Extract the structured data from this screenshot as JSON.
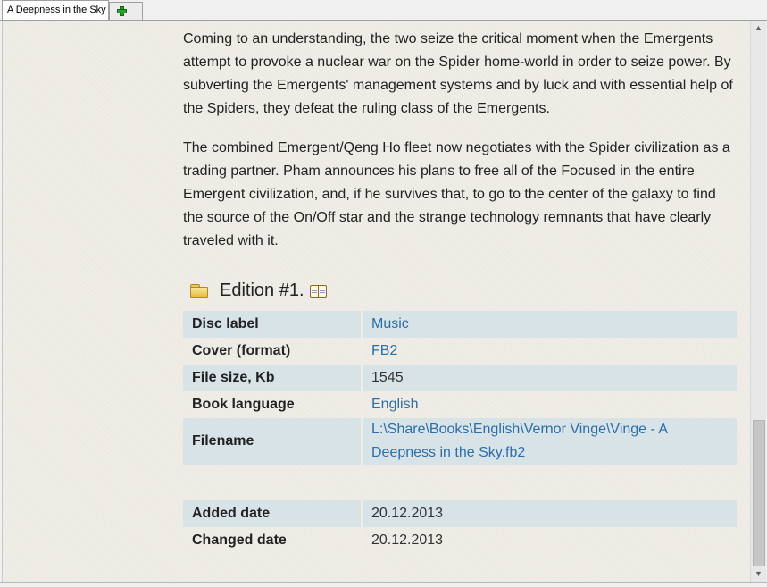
{
  "tabs": {
    "active_label": "A Deepness in the Sky",
    "add_label": "+"
  },
  "description": {
    "paragraphs": [
      "Coming to an understanding, the two seize the critical moment when the Emergents attempt to provoke a nuclear war on the Spider home-world in order to seize power. By subverting the Emergents' management systems and by luck and with essential help of the Spiders, they defeat the ruling class of the Emergents.",
      "The combined Emergent/Qeng Ho fleet now negotiates with the Spider civilization as a trading partner. Pham announces his plans to free all of the Focused in the entire Emergent civilization, and, if he survives that, to go to the center of the galaxy to find the source of the On/Off star and the strange technology remnants that have clearly traveled with it."
    ]
  },
  "edition": {
    "title": "Edition #1.",
    "rows": [
      {
        "label": "Disc label",
        "value": "Music"
      },
      {
        "label": "Cover (format)",
        "value": "FB2"
      },
      {
        "label": "File size, Kb",
        "value": "1545"
      },
      {
        "label": "Book language",
        "value": "English"
      },
      {
        "label": "Filename",
        "value": "L:\\Share\\Books\\English\\Vernor Vinge\\Vinge - A Deepness in the Sky.fb2"
      },
      {
        "label": "Added date",
        "value": "20.12.2013"
      },
      {
        "label": "Changed date",
        "value": "20.12.2013"
      }
    ]
  },
  "colors": {
    "row_shade": "#d8e3e8",
    "link": "#2b6ea8",
    "background": "#efede6"
  },
  "icons": {
    "tab_add": "plus-icon",
    "edition": "folder-open-icon",
    "edition_action": "book-icon"
  }
}
